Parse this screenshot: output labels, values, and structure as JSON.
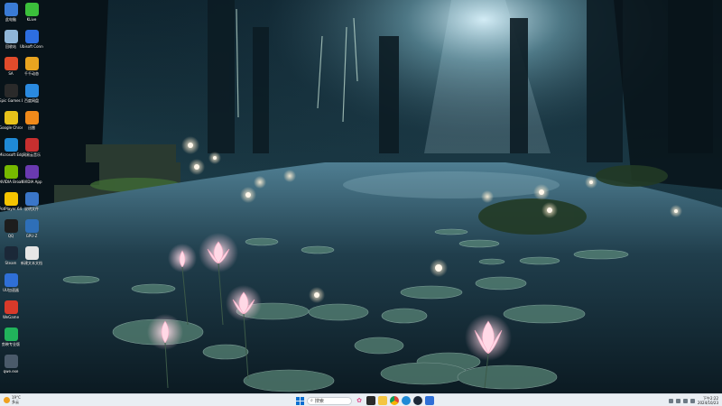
{
  "desktop": {
    "icons_col1": [
      {
        "label": "此电脑",
        "icon": "computer-icon",
        "color": "#3a7bd5"
      },
      {
        "label": "回收站",
        "icon": "recycle-bin-icon",
        "color": "#8fb6d8"
      },
      {
        "label": "SA",
        "icon": "app-icon",
        "color": "#e04b2b"
      },
      {
        "label": "Epic Games Launcher",
        "icon": "epic-games-icon",
        "color": "#2a2a2a"
      },
      {
        "label": "Google Chrome",
        "icon": "chrome-icon",
        "color": "#e8c21a"
      },
      {
        "label": "Microsoft Edge",
        "icon": "edge-icon",
        "color": "#1f8ad6"
      },
      {
        "label": "NVIDIA Broadcast",
        "icon": "nvidia-icon",
        "color": "#76b900"
      },
      {
        "label": "PotPlayer 64 bit",
        "icon": "potplayer-icon",
        "color": "#f5c400"
      },
      {
        "label": "QQ",
        "icon": "qq-icon",
        "color": "#1d1d1d"
      },
      {
        "label": "Steam",
        "icon": "steam-icon",
        "color": "#1b2838"
      },
      {
        "label": "UU加速器",
        "icon": "uu-icon",
        "color": "#2f6fd6"
      },
      {
        "label": "WeGame",
        "icon": "wegame-icon",
        "color": "#d83a2a"
      },
      {
        "label": "剪映专业版",
        "icon": "player-icon",
        "color": "#21b35b"
      },
      {
        "label": "qwe.exe",
        "icon": "exe-icon",
        "color": "#4a5a6a"
      }
    ],
    "icons_col2": [
      {
        "label": "KLive",
        "icon": "klive-icon",
        "color": "#3bbf3b"
      },
      {
        "label": "Ubisoft Connect",
        "icon": "ubisoft-icon",
        "color": "#2d6ee0"
      },
      {
        "label": "千千动态",
        "icon": "owl-icon",
        "color": "#e8a420"
      },
      {
        "label": "百度网盘",
        "icon": "cloud-icon",
        "color": "#2a8ae0"
      },
      {
        "label": "迅雷",
        "icon": "thunder-icon",
        "color": "#f08a1a"
      },
      {
        "label": "网易云音乐",
        "icon": "music-icon",
        "color": "#c62f2f"
      },
      {
        "label": "NVIDIA App",
        "icon": "nv-app-icon",
        "color": "#6a3ab0"
      },
      {
        "label": "说明文件",
        "icon": "doc-icon",
        "color": "#3a76c8"
      },
      {
        "label": "GPU-Z",
        "icon": "gpu-icon",
        "color": "#2e6fb8"
      },
      {
        "label": "新建文本文档",
        "icon": "text-file-icon",
        "color": "#e6e6e6"
      }
    ]
  },
  "taskbar": {
    "weather_temp": "19°C",
    "weather_desc": "多云",
    "search_placeholder": "搜索",
    "time": "下午2:22",
    "date": "2024/10/23",
    "accent": "#0067c0"
  }
}
